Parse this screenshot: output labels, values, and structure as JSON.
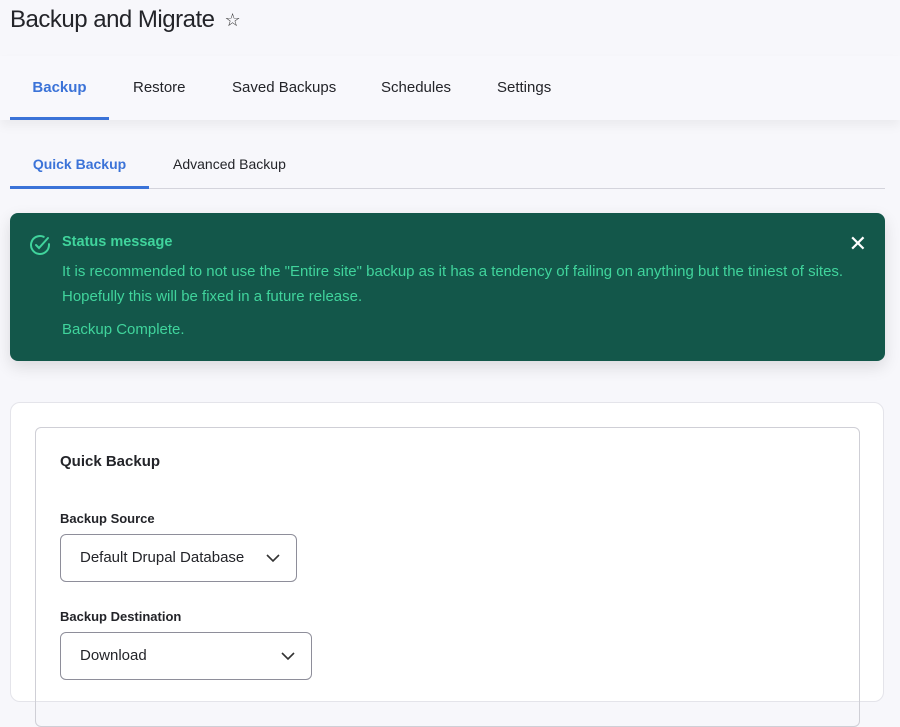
{
  "page": {
    "title": "Backup and Migrate"
  },
  "primary_tabs": [
    {
      "label": "Backup",
      "active": true
    },
    {
      "label": "Restore"
    },
    {
      "label": "Saved Backups"
    },
    {
      "label": "Schedules"
    },
    {
      "label": "Settings"
    }
  ],
  "secondary_tabs": [
    {
      "label": "Quick Backup",
      "active": true
    },
    {
      "label": "Advanced Backup"
    }
  ],
  "status": {
    "heading": "Status message",
    "messages": [
      "It is recommended to not use the \"Entire site\" backup as it has a tendency of failing on anything but the tiniest of sites. Hopefully this will be fixed in a future release.",
      "Backup Complete."
    ]
  },
  "form": {
    "legend": "Quick Backup",
    "source_label": "Backup Source",
    "source_value": "Default Drupal Database",
    "destination_label": "Backup Destination",
    "destination_value": "Download"
  },
  "colors": {
    "accent": "#3b73d8",
    "status_bg": "#13574a",
    "status_text": "#40d49c"
  }
}
